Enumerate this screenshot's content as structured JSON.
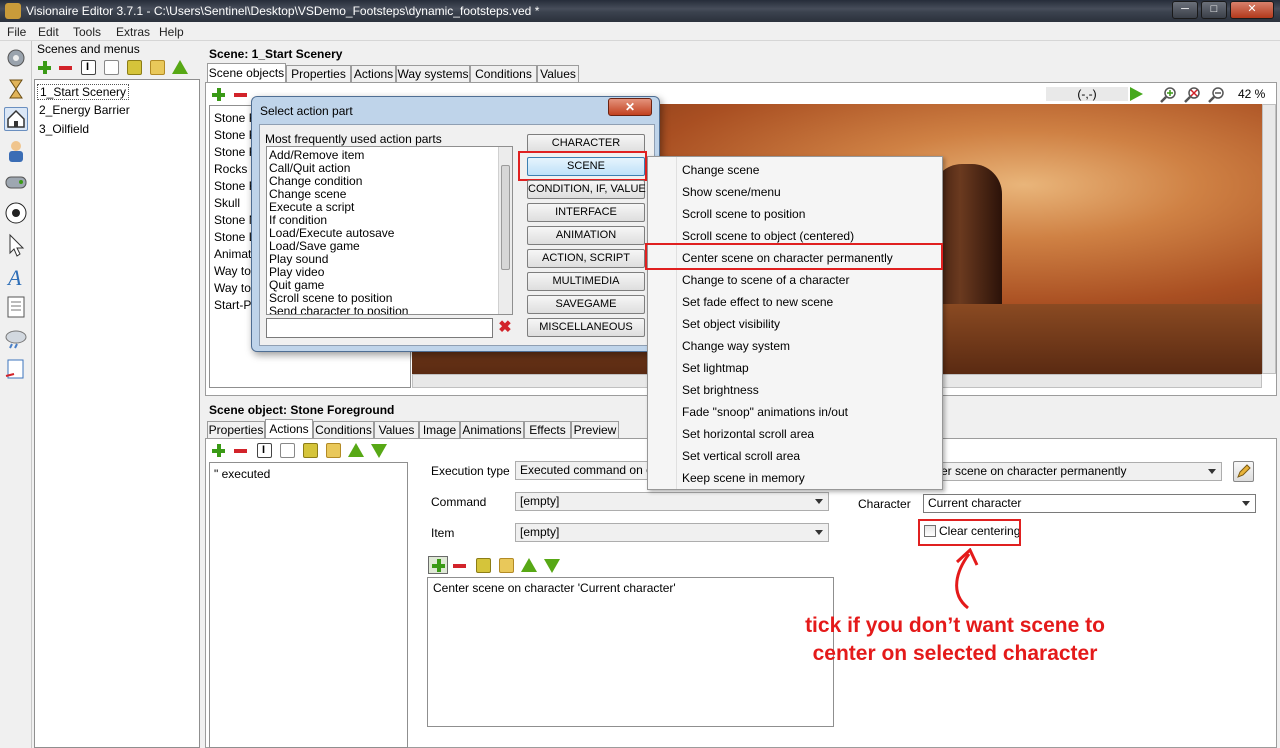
{
  "window": {
    "title": "Visionaire Editor 3.7.1 - C:\\Users\\Sentinel\\Desktop\\VSDemo_Footsteps\\dynamic_footsteps.ved *"
  },
  "menu": [
    "File",
    "Edit",
    "Tools",
    "Extras",
    "Help"
  ],
  "scenes_panel": {
    "title": "Scenes and menus",
    "items": [
      "1_Start Scenery",
      "2_Energy Barrier",
      "3_Oilfield"
    ]
  },
  "scene": {
    "title": "Scene: 1_Start Scenery",
    "tabs": [
      "Scene objects",
      "Properties",
      "Actions",
      "Way systems",
      "Conditions",
      "Values"
    ],
    "objects": [
      "Stone F",
      "Stone F",
      "Stone F",
      "Rocks in",
      "Stone F",
      "Skull",
      "Stone M",
      "Stone L",
      "Animati",
      "Way to",
      "Way to",
      "Start-P"
    ],
    "coords": "(-,-)",
    "zoom": "42 %"
  },
  "dialog": {
    "title": "Select action part",
    "list_label": "Most frequently used action parts",
    "items": [
      "Add/Remove item",
      "Call/Quit action",
      "Change condition",
      "Change scene",
      "Execute a script",
      "If condition",
      "Load/Execute autosave",
      "Load/Save game",
      "Play sound",
      "Play video",
      "Quit game",
      "Scroll scene to position",
      "Send character to position"
    ],
    "search_value": "",
    "categories": [
      "CHARACTER",
      "SCENE",
      "CONDITION, IF, VALUE",
      "INTERFACE",
      "ANIMATION",
      "ACTION, SCRIPT",
      "MULTIMEDIA",
      "SAVEGAME",
      "MISCELLANEOUS"
    ]
  },
  "popup": {
    "items": [
      "Change scene",
      "Show scene/menu",
      "Scroll scene to position",
      "Scroll scene to object (centered)",
      "Center scene on character permanently",
      "Change to scene of a character",
      "Set fade effect to new scene",
      "Set object visibility",
      "Change way system",
      "Set lightmap",
      "Set brightness",
      "Fade \"snoop\" animations in/out",
      "Set horizontal scroll area",
      "Set vertical scroll area",
      "Keep scene in memory"
    ]
  },
  "object": {
    "title": "Scene object: Stone Foreground",
    "tabs": [
      "Properties",
      "Actions",
      "Conditions",
      "Values",
      "Image",
      "Animations",
      "Effects",
      "Preview"
    ],
    "actions": [
      "\" executed"
    ]
  },
  "form": {
    "execution_type_label": "Execution type",
    "execution_type_value": "Executed command on obje",
    "command_label": "Command",
    "command_value": "[empty]",
    "item_label": "Item",
    "item_value": "[empty]",
    "action_part": "nter scene on character permanently",
    "character_label": "Character",
    "character_value": "Current character",
    "clear_label": "Clear centering"
  },
  "action_list": [
    "Center scene on character 'Current character'"
  ],
  "annotation": [
    "tick if you don’t want scene to",
    "center on selected character"
  ]
}
